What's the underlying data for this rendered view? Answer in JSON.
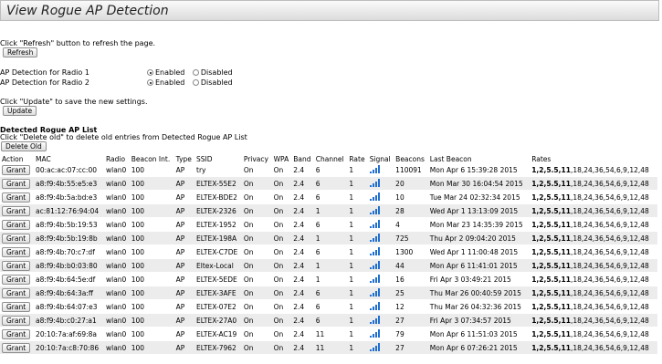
{
  "page_title": "View Rogue AP Detection",
  "refresh_hint": "Click \"Refresh\" button to refresh the page.",
  "refresh_button": "Refresh",
  "radio1_label": "AP Detection for Radio 1",
  "radio2_label": "AP Detection for Radio 2",
  "enabled_label": "Enabled",
  "disabled_label": "Disabled",
  "update_hint": "Click \"Update\" to save the new settings.",
  "update_button": "Update",
  "list_title": "Detected Rogue AP List",
  "delete_hint": "Click \"Delete old\" to delete old entries from Detected Rogue AP List",
  "delete_button": "Delete Old",
  "columns": [
    "Action",
    "MAC",
    "Radio",
    "Beacon Int.",
    "Type",
    "SSID",
    "Privacy",
    "WPA",
    "Band",
    "Channel",
    "Rate",
    "Signal",
    "Beacons",
    "Last Beacon",
    "Rates"
  ],
  "grant_label": "Grant",
  "rates_bold": "1,2,5.5,11",
  "rates_rest": ",18,24,36,54,6,9,12,48",
  "signal_color": "#1f6fd0",
  "rows": [
    {
      "mac": "00:ac:ac:07:cc:00",
      "radio": "wlan0",
      "beacon_int": "100",
      "type": "AP",
      "ssid": "try",
      "privacy": "On",
      "wpa": "On",
      "band": "2.4",
      "channel": "6",
      "rate": "1",
      "signal_bars": 4,
      "beacons": "110091",
      "last_beacon": "Mon Apr 6 15:39:28 2015"
    },
    {
      "mac": "a8:f9:4b:55:e5:e3",
      "radio": "wlan0",
      "beacon_int": "100",
      "type": "AP",
      "ssid": "ELTEX-55E2",
      "privacy": "On",
      "wpa": "On",
      "band": "2.4",
      "channel": "6",
      "rate": "1",
      "signal_bars": 4,
      "beacons": "20",
      "last_beacon": "Mon Mar 30 16:04:54 2015"
    },
    {
      "mac": "a8:f9:4b:5a:bd:e3",
      "radio": "wlan0",
      "beacon_int": "100",
      "type": "AP",
      "ssid": "ELTEX-BDE2",
      "privacy": "On",
      "wpa": "On",
      "band": "2.4",
      "channel": "6",
      "rate": "1",
      "signal_bars": 4,
      "beacons": "10",
      "last_beacon": "Tue Mar 24 02:32:34 2015"
    },
    {
      "mac": "ac:81:12:76:94:04",
      "radio": "wlan0",
      "beacon_int": "100",
      "type": "AP",
      "ssid": "ELTEX-2326",
      "privacy": "On",
      "wpa": "On",
      "band": "2.4",
      "channel": "1",
      "rate": "1",
      "signal_bars": 4,
      "beacons": "28",
      "last_beacon": "Wed Apr 1 13:13:09 2015"
    },
    {
      "mac": "a8:f9:4b:5b:19:53",
      "radio": "wlan0",
      "beacon_int": "100",
      "type": "AP",
      "ssid": "ELTEX-1952",
      "privacy": "On",
      "wpa": "On",
      "band": "2.4",
      "channel": "6",
      "rate": "1",
      "signal_bars": 4,
      "beacons": "4",
      "last_beacon": "Mon Mar 23 14:35:39 2015"
    },
    {
      "mac": "a8:f9:4b:5b:19:8b",
      "radio": "wlan0",
      "beacon_int": "100",
      "type": "AP",
      "ssid": "ELTEX-198A",
      "privacy": "On",
      "wpa": "On",
      "band": "2.4",
      "channel": "1",
      "rate": "1",
      "signal_bars": 4,
      "beacons": "725",
      "last_beacon": "Thu Apr 2 09:04:20 2015"
    },
    {
      "mac": "a8:f9:4b:70:c7:df",
      "radio": "wlan0",
      "beacon_int": "100",
      "type": "AP",
      "ssid": "ELTEX-C7DE",
      "privacy": "On",
      "wpa": "On",
      "band": "2.4",
      "channel": "6",
      "rate": "1",
      "signal_bars": 4,
      "beacons": "1300",
      "last_beacon": "Wed Apr 1 11:00:48 2015"
    },
    {
      "mac": "a8:f9:4b:b0:03:80",
      "radio": "wlan0",
      "beacon_int": "100",
      "type": "AP",
      "ssid": "Eltex-Local",
      "privacy": "On",
      "wpa": "On",
      "band": "2.4",
      "channel": "1",
      "rate": "1",
      "signal_bars": 4,
      "beacons": "44",
      "last_beacon": "Mon Apr 6 11:41:01 2015"
    },
    {
      "mac": "a8:f9:4b:64:5e:df",
      "radio": "wlan0",
      "beacon_int": "100",
      "type": "AP",
      "ssid": "ELTEX-5EDE",
      "privacy": "On",
      "wpa": "On",
      "band": "2.4",
      "channel": "1",
      "rate": "1",
      "signal_bars": 4,
      "beacons": "16",
      "last_beacon": "Fri Apr 3 03:49:21 2015"
    },
    {
      "mac": "a8:f9:4b:64:3a:ff",
      "radio": "wlan0",
      "beacon_int": "100",
      "type": "AP",
      "ssid": "ELTEX-3AFE",
      "privacy": "On",
      "wpa": "On",
      "band": "2.4",
      "channel": "6",
      "rate": "1",
      "signal_bars": 4,
      "beacons": "25",
      "last_beacon": "Thu Mar 26 00:40:59 2015"
    },
    {
      "mac": "a8:f9:4b:64:07:e3",
      "radio": "wlan0",
      "beacon_int": "100",
      "type": "AP",
      "ssid": "ELTEX-07E2",
      "privacy": "On",
      "wpa": "On",
      "band": "2.4",
      "channel": "6",
      "rate": "1",
      "signal_bars": 4,
      "beacons": "12",
      "last_beacon": "Thu Mar 26 04:32:36 2015"
    },
    {
      "mac": "a8:f9:4b:c0:27:a1",
      "radio": "wlan0",
      "beacon_int": "100",
      "type": "AP",
      "ssid": "ELTEX-27A0",
      "privacy": "On",
      "wpa": "On",
      "band": "2.4",
      "channel": "6",
      "rate": "1",
      "signal_bars": 4,
      "beacons": "27",
      "last_beacon": "Fri Apr 3 07:34:57 2015"
    },
    {
      "mac": "20:10:7a:af:69:8a",
      "radio": "wlan0",
      "beacon_int": "100",
      "type": "AP",
      "ssid": "ELTEX-AC19",
      "privacy": "On",
      "wpa": "On",
      "band": "2.4",
      "channel": "11",
      "rate": "1",
      "signal_bars": 4,
      "beacons": "79",
      "last_beacon": "Mon Apr 6 11:51:03 2015"
    },
    {
      "mac": "20:10:7a:c8:70:86",
      "radio": "wlan0",
      "beacon_int": "100",
      "type": "AP",
      "ssid": "ELTEX-7962",
      "privacy": "On",
      "wpa": "On",
      "band": "2.4",
      "channel": "11",
      "rate": "1",
      "signal_bars": 4,
      "beacons": "27",
      "last_beacon": "Mon Apr 6 07:26:21 2015"
    }
  ]
}
